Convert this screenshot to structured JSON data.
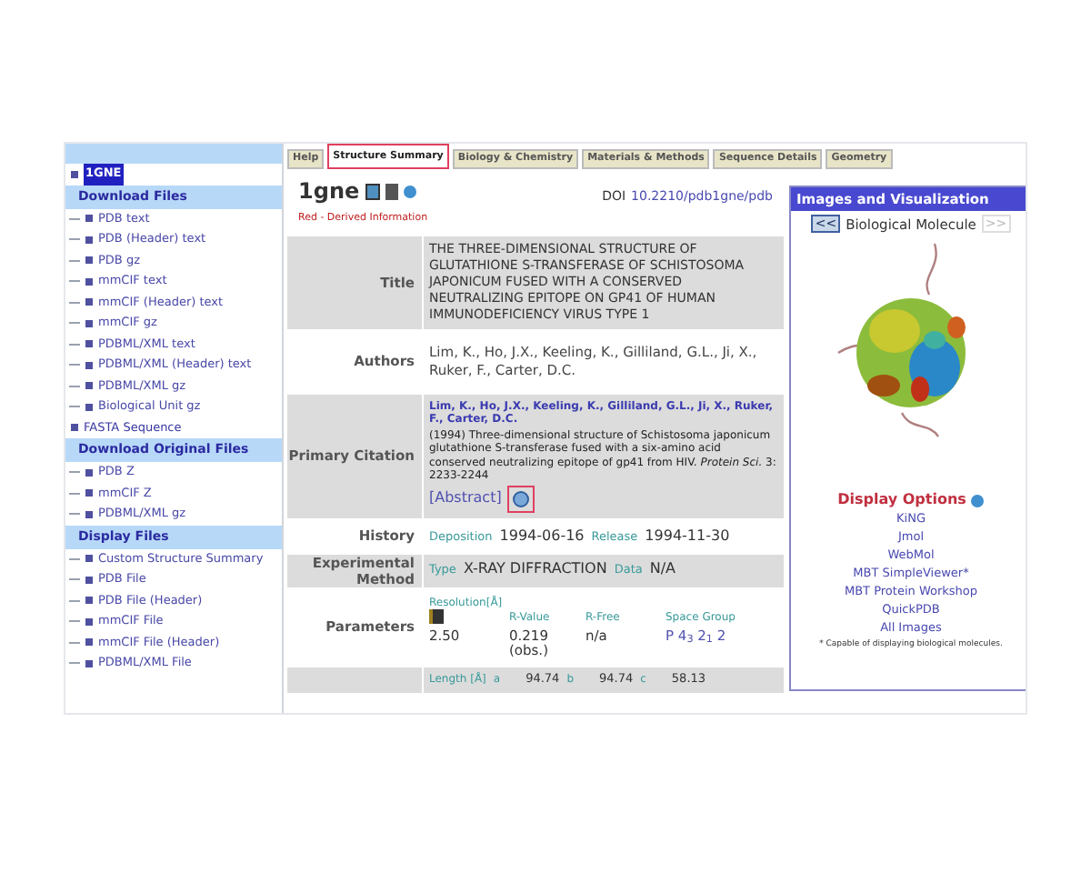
{
  "tabs": [
    {
      "label": "Help",
      "selected": false,
      "highlighted": false
    },
    {
      "label": "Structure Summary",
      "selected": true,
      "highlighted": true
    },
    {
      "label": "Biology & Chemistry",
      "selected": false,
      "highlighted": false
    },
    {
      "label": "Materials & Methods",
      "selected": false,
      "highlighted": false
    },
    {
      "label": "Sequence Details",
      "selected": false,
      "highlighted": false
    },
    {
      "label": "Geometry",
      "selected": false,
      "highlighted": false
    }
  ],
  "sidebar": {
    "items": [
      {
        "kind": "entry",
        "label": "1GNE",
        "selected": true
      },
      {
        "kind": "header",
        "label": "Download Files",
        "children": [
          {
            "label": "PDB text"
          },
          {
            "label": "PDB (Header) text"
          },
          {
            "label": "PDB gz"
          },
          {
            "label": "mmCIF text"
          },
          {
            "label": "mmCIF (Header) text"
          },
          {
            "label": "mmCIF gz"
          },
          {
            "label": "PDBML/XML text"
          },
          {
            "label": "PDBML/XML (Header) text"
          },
          {
            "label": "PDBML/XML gz"
          },
          {
            "label": "Biological Unit gz"
          }
        ]
      },
      {
        "kind": "entry",
        "label": "FASTA Sequence",
        "selected": false
      },
      {
        "kind": "header",
        "label": "Download Original Files",
        "children": [
          {
            "label": "PDB Z"
          },
          {
            "label": "mmCIF Z"
          },
          {
            "label": "PDBML/XML gz"
          }
        ]
      },
      {
        "kind": "header",
        "label": "Display Files",
        "children": [
          {
            "label": "Custom Structure Summary"
          },
          {
            "label": "PDB File"
          },
          {
            "label": "PDB File (Header)"
          },
          {
            "label": "mmCIF File"
          },
          {
            "label": "mmCIF File (Header)"
          },
          {
            "label": "PDBML/XML File"
          }
        ]
      }
    ]
  },
  "entry": {
    "id": "1gne",
    "doi_label": "DOI",
    "doi": "10.2210/pdb1gne/pdb",
    "legend": "Red - Derived Information"
  },
  "rows": [
    {
      "kind": "text",
      "label": "Title",
      "text": "THE THREE-DIMENSIONAL STRUCTURE OF GLUTATHIONE S-TRANSFERASE OF SCHISTOSOMA JAPONICUM FUSED WITH A CONSERVED NEUTRALIZING EPITOPE ON GP41 OF HUMAN IMMUNODEFICIENCY VIRUS TYPE 1"
    },
    {
      "kind": "authors",
      "label": "Authors",
      "text": "Lim, K., Ho, J.X., Keeling, K., Gilliland, G.L., Ji, X., Ruker, F., Carter, D.C."
    },
    {
      "kind": "citation",
      "label": "Primary Citation",
      "authors": "Lim, K., Ho, J.X., Keeling, K., Gilliland, G.L., Ji, X., Ruker, F., Carter, D.C.",
      "text": "(1994) Three-dimensional structure of Schistosoma japonicum glutathione S-transferase fused with a six-amino acid conserved neutralizing epitope of gp41 from HIV.",
      "journal": "Protein Sci.",
      "pages": "3: 2233-2244",
      "abstract": "[Abstract]",
      "pubmed_highlighted": true
    },
    {
      "kind": "history",
      "label": "History",
      "fields": [
        {
          "name": "Deposition",
          "value": "1994-06-16"
        },
        {
          "name": "Release",
          "value": "1994-11-30"
        }
      ]
    },
    {
      "kind": "history",
      "label": "Experimental Method",
      "fields": [
        {
          "name": "Type",
          "value": "X-RAY DIFFRACTION"
        },
        {
          "name": "Data",
          "value": "N/A"
        }
      ]
    },
    {
      "kind": "params",
      "label": "Parameters",
      "columns": [
        "Resolution[Å]",
        "R-Value",
        "R-Free",
        "Space Group"
      ],
      "values": [
        "2.50",
        "0.219 (obs.)",
        "n/a",
        "P 4$_{3}$ 2$_{1}$ 2"
      ]
    },
    {
      "kind": "cell",
      "fields": [
        {
          "name": "Length [Å]"
        },
        {
          "name": "a",
          "value": "94.74"
        },
        {
          "name": "b",
          "value": "94.74"
        },
        {
          "name": "c",
          "value": "58.13"
        }
      ]
    }
  ],
  "viz": {
    "title": "Images and Visualization",
    "prev": "<<",
    "caption": "Biological Molecule",
    "next": ">>",
    "next_disabled": true,
    "options_title": "Display Options",
    "options": [
      "KiNG",
      "Jmol",
      "WebMol",
      "MBT SimpleViewer*",
      "MBT Protein Workshop",
      "QuickPDB",
      "All Images"
    ],
    "footnote": "* Capable of displaying biological molecules."
  }
}
